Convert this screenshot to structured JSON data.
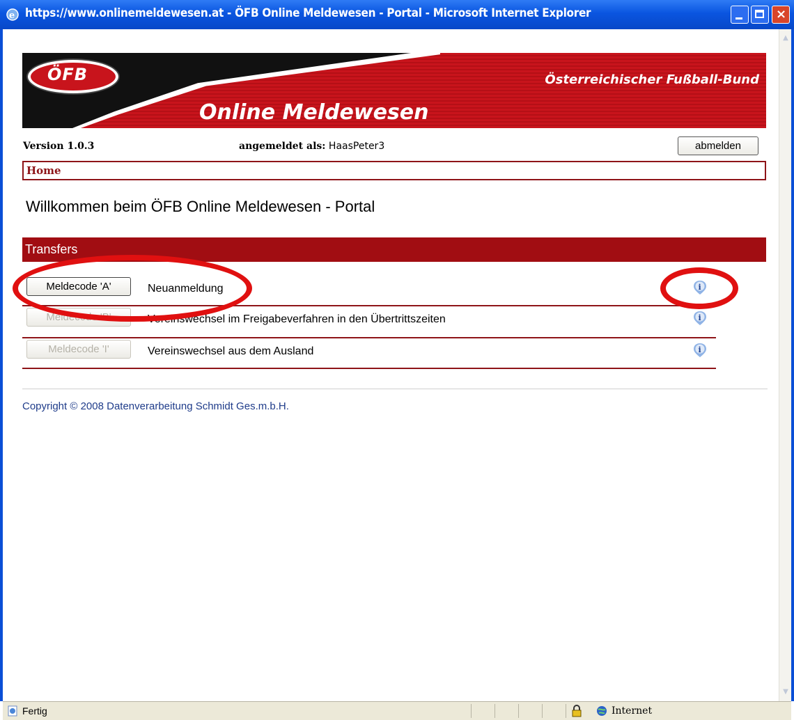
{
  "window": {
    "title": "https://www.onlinemeldewesen.at - ÖFB Online Meldewesen - Portal - Microsoft Internet Explorer",
    "controls": {
      "minimize": "minimize-icon",
      "maximize": "maximize-icon",
      "close": "close-icon"
    }
  },
  "banner": {
    "logo_text": "ÖFB",
    "org_name": "Österreichischer Fußball-Bund",
    "app_name": "Online Meldewesen"
  },
  "info": {
    "version": "Version 1.0.3",
    "logged_in_label": "angemeldet als:",
    "username": "HaasPeter3",
    "logout_label": "abmelden"
  },
  "breadcrumb": {
    "home": "Home"
  },
  "main": {
    "welcome": "Willkommen beim ÖFB Online Meldewesen - Portal",
    "section_title": "Transfers",
    "rows": [
      {
        "button": "Meldecode 'A'",
        "enabled": true,
        "description": "Neuanmeldung",
        "icon": "info-icon"
      },
      {
        "button": "Meldecode 'B'",
        "enabled": false,
        "description": "Vereinswechsel im Freigabeverfahren in den Übertrittszeiten",
        "icon": "info-icon"
      },
      {
        "button": "Meldecode 'I'",
        "enabled": false,
        "description": "Vereinswechsel aus dem Ausland",
        "icon": "info-icon"
      }
    ]
  },
  "footer": {
    "copyright": "Copyright © 2008 Datenverarbeitung Schmidt Ges.m.b.H."
  },
  "statusbar": {
    "status": "Fertig",
    "zone": "Internet"
  },
  "colors": {
    "brand_red": "#a10d12",
    "titlebar_blue": "#0a55e0",
    "annotation_red": "#e01010"
  }
}
